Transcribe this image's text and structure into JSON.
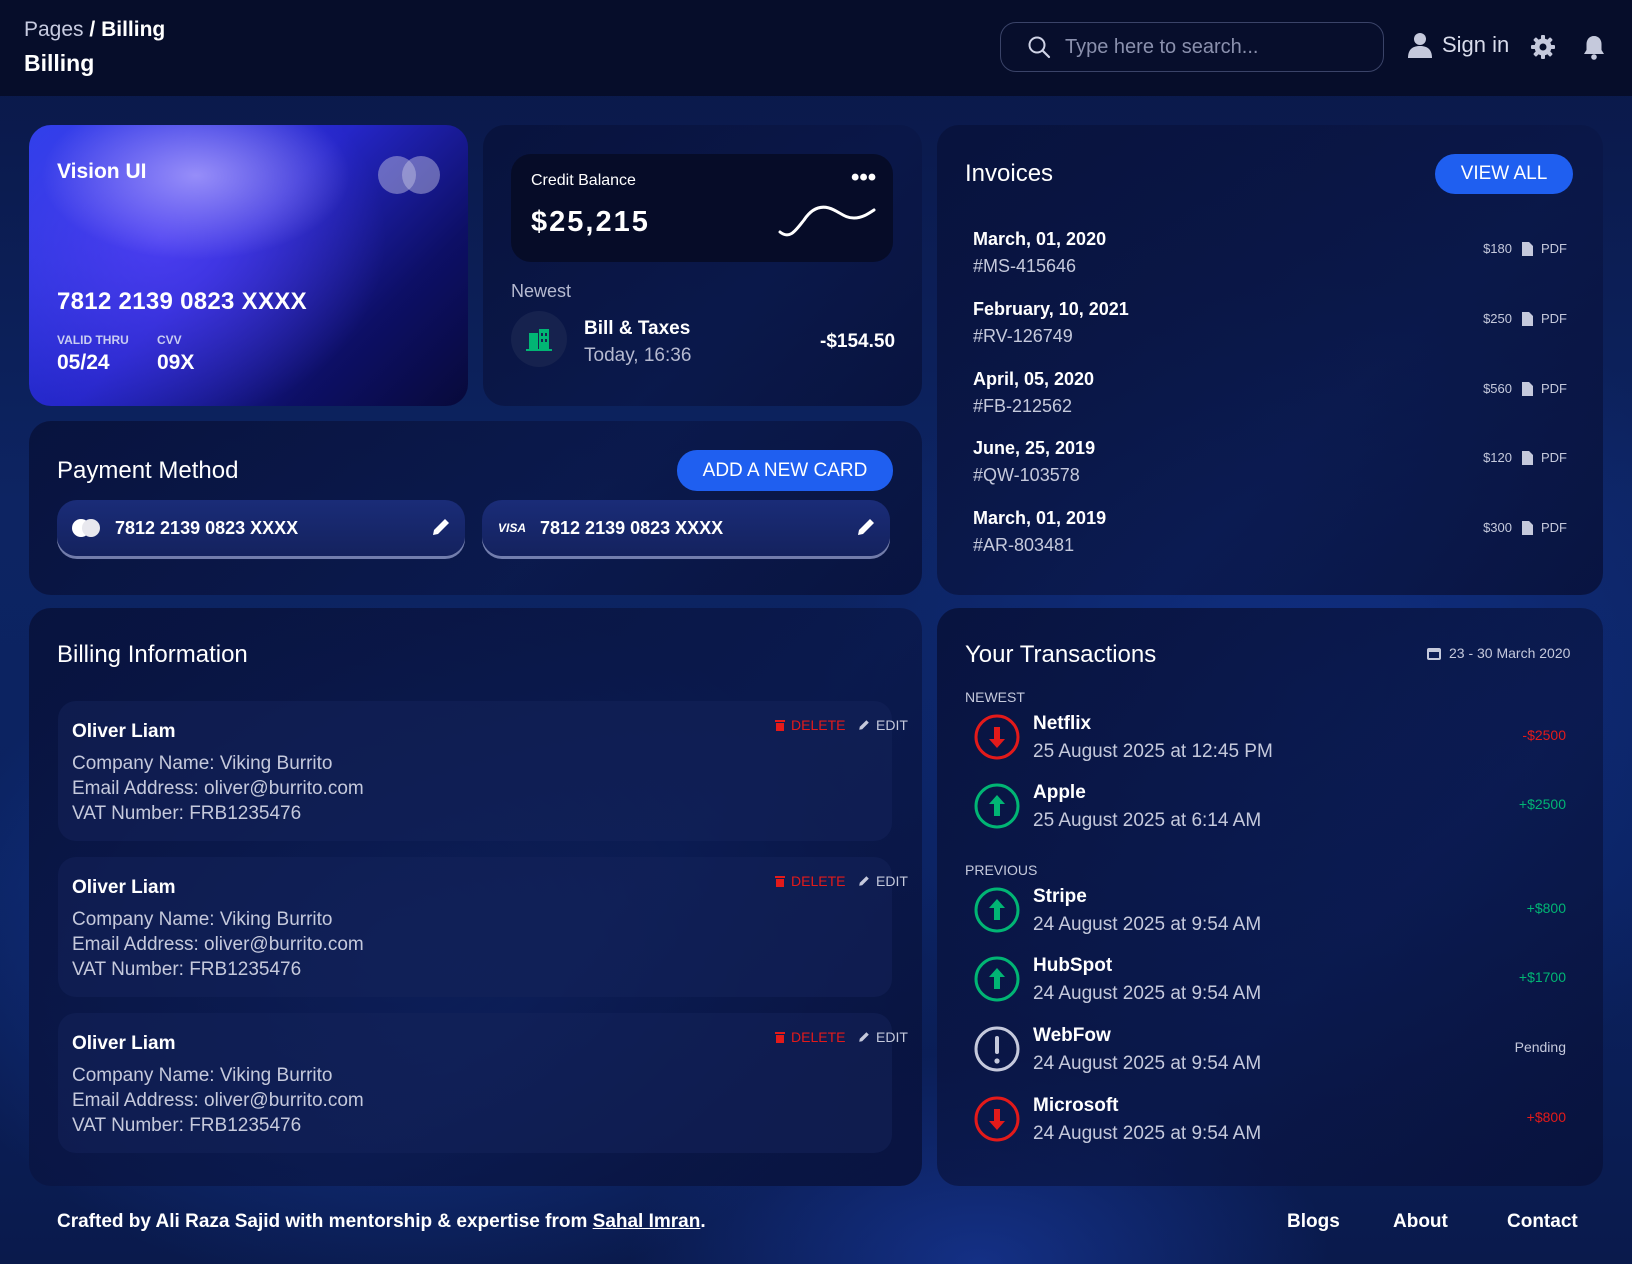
{
  "header": {
    "breadcrumb_root": "Pages",
    "breadcrumb_sep": "/",
    "breadcrumb_current": "Billing",
    "title": "Billing",
    "search_placeholder": "Type here to search...",
    "signin_label": "Sign in"
  },
  "vision_card": {
    "brand": "Vision UI",
    "number": "7812 2139 0823 XXXX",
    "valid_label": "VALID THRU",
    "valid_value": "05/24",
    "cvv_label": "CVV",
    "cvv_value": "09X"
  },
  "balance": {
    "label": "Credit Balance",
    "amount": "$25,215",
    "menu": "•••",
    "newest_label": "Newest",
    "item_title": "Bill & Taxes",
    "item_date": "Today, 16:36",
    "item_amount": "-$154.50"
  },
  "invoices": {
    "title": "Invoices",
    "view_all": "VIEW ALL",
    "pdf_label": "PDF",
    "items": [
      {
        "date": "March, 01, 2020",
        "id": "#MS-415646",
        "amount": "$180"
      },
      {
        "date": "February, 10, 2021",
        "id": "#RV-126749",
        "amount": "$250"
      },
      {
        "date": "April, 05, 2020",
        "id": "#FB-212562",
        "amount": "$560"
      },
      {
        "date": "June, 25, 2019",
        "id": "#QW-103578",
        "amount": "$120"
      },
      {
        "date": "March, 01, 2019",
        "id": "#AR-803481",
        "amount": "$300"
      }
    ]
  },
  "payment": {
    "title": "Payment Method",
    "add_button": "ADD A NEW CARD",
    "cards": [
      {
        "brand": "mastercard",
        "number": "7812 2139 0823 XXXX"
      },
      {
        "brand": "VISA",
        "number": "7812 2139 0823 XXXX"
      }
    ]
  },
  "billing": {
    "title": "Billing Information",
    "delete_label": "DELETE",
    "edit_label": "EDIT",
    "items": [
      {
        "name": "Oliver Liam",
        "company": "Company Name: Viking Burrito",
        "email": "Email Address: oliver@burrito.com",
        "vat": "VAT Number: FRB1235476"
      },
      {
        "name": "Oliver Liam",
        "company": "Company Name: Viking Burrito",
        "email": "Email Address: oliver@burrito.com",
        "vat": "VAT Number: FRB1235476"
      },
      {
        "name": "Oliver Liam",
        "company": "Company Name: Viking Burrito",
        "email": "Email Address: oliver@burrito.com",
        "vat": "VAT Number: FRB1235476"
      }
    ]
  },
  "transactions": {
    "title": "Your Transactions",
    "range": "23 - 30 March 2020",
    "newest_label": "NEWEST",
    "previous_label": "PREVIOUS",
    "items": [
      {
        "name": "Netflix",
        "date": "25 August 2025 at 12:45 PM",
        "amount": "-$2500",
        "kind": "down",
        "color": "#e31a1a"
      },
      {
        "name": "Apple",
        "date": "25 August 2025 at 6:14 AM",
        "amount": "+$2500",
        "kind": "up",
        "color": "#01b574"
      },
      {
        "name": "Stripe",
        "date": "24 August 2025 at 9:54 AM",
        "amount": "+$800",
        "kind": "up",
        "color": "#01b574"
      },
      {
        "name": "HubSpot",
        "date": "24 August 2025 at 9:54 AM",
        "amount": "+$1700",
        "kind": "up",
        "color": "#01b574"
      },
      {
        "name": "WebFow",
        "date": "24 August 2025 at 9:54 AM",
        "amount": "Pending",
        "kind": "pending",
        "color": "#c5c9dc"
      },
      {
        "name": "Microsoft",
        "date": "24 August 2025 at 9:54 AM",
        "amount": "+$800",
        "kind": "down",
        "color": "#e31a1a"
      }
    ]
  },
  "footer": {
    "text": "Crafted by Ali Raza Sajid with mentorship & expertise from",
    "link": "Sahal Imran",
    "period": ".",
    "links": [
      "Blogs",
      "About",
      "Contact"
    ]
  },
  "colors": {
    "accent": "#1f5ff0",
    "negative": "#e31a1a",
    "positive": "#01b574"
  }
}
